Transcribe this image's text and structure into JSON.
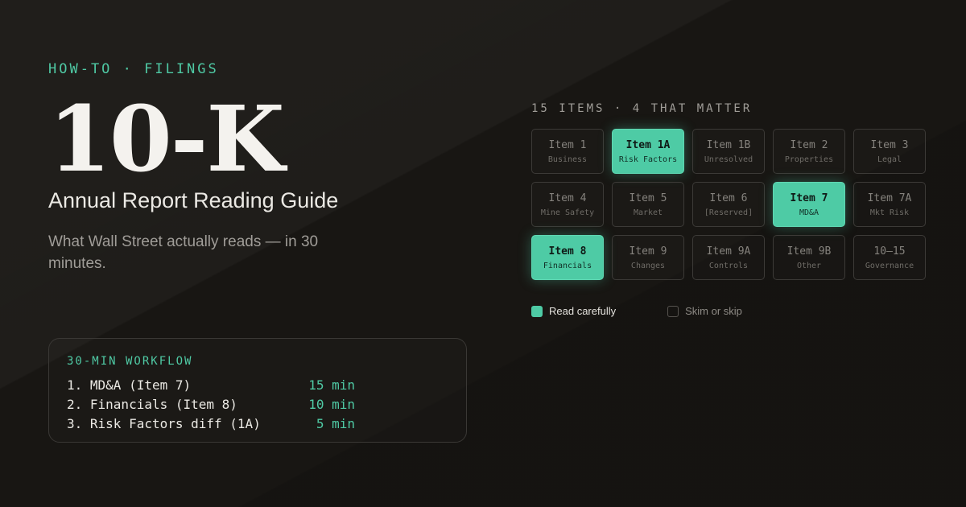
{
  "header": {
    "eyebrow": "HOW-TO · FILINGS",
    "title": "10-K",
    "subtitle": "Annual Report Reading Guide",
    "tagline": "What Wall Street actually reads — in 30 minutes."
  },
  "workflow": {
    "title": "30-MIN WORKFLOW",
    "steps": [
      {
        "task": "1. MD&A (Item 7)",
        "time": "15 min"
      },
      {
        "task": "2. Financials (Item 8)",
        "time": "10 min"
      },
      {
        "task": "3. Risk Factors diff (1A)",
        "time": "5 min"
      }
    ]
  },
  "grid": {
    "title": "15 ITEMS · 4 THAT MATTER",
    "items": [
      {
        "num": "Item 1",
        "sub": "Business",
        "highlight": false
      },
      {
        "num": "Item 1A",
        "sub": "Risk Factors",
        "highlight": true
      },
      {
        "num": "Item 1B",
        "sub": "Unresolved",
        "highlight": false
      },
      {
        "num": "Item 2",
        "sub": "Properties",
        "highlight": false
      },
      {
        "num": "Item 3",
        "sub": "Legal",
        "highlight": false
      },
      {
        "num": "Item 4",
        "sub": "Mine Safety",
        "highlight": false
      },
      {
        "num": "Item 5",
        "sub": "Market",
        "highlight": false
      },
      {
        "num": "Item 6",
        "sub": "[Reserved]",
        "highlight": false
      },
      {
        "num": "Item 7",
        "sub": "MD&A",
        "highlight": true
      },
      {
        "num": "Item 7A",
        "sub": "Mkt Risk",
        "highlight": false
      },
      {
        "num": "Item 8",
        "sub": "Financials",
        "highlight": true
      },
      {
        "num": "Item 9",
        "sub": "Changes",
        "highlight": false
      },
      {
        "num": "Item 9A",
        "sub": "Controls",
        "highlight": false
      },
      {
        "num": "Item 9B",
        "sub": "Other",
        "highlight": false
      },
      {
        "num": "10–15",
        "sub": "Governance",
        "highlight": false
      }
    ]
  },
  "legend": {
    "read": "Read carefully",
    "skim": "Skim or skip"
  },
  "colors": {
    "accent": "#4ecba5",
    "background": "#181613"
  }
}
